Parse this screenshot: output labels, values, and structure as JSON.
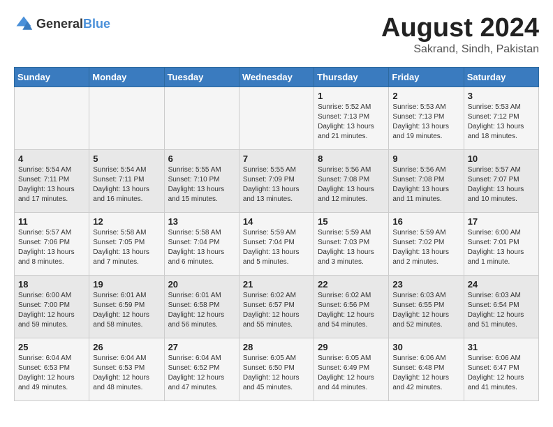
{
  "logo": {
    "text_general": "General",
    "text_blue": "Blue"
  },
  "header": {
    "month_year": "August 2024",
    "location": "Sakrand, Sindh, Pakistan"
  },
  "days_of_week": [
    "Sunday",
    "Monday",
    "Tuesday",
    "Wednesday",
    "Thursday",
    "Friday",
    "Saturday"
  ],
  "weeks": [
    [
      {
        "day": "",
        "content": ""
      },
      {
        "day": "",
        "content": ""
      },
      {
        "day": "",
        "content": ""
      },
      {
        "day": "",
        "content": ""
      },
      {
        "day": "1",
        "content": "Sunrise: 5:52 AM\nSunset: 7:13 PM\nDaylight: 13 hours\nand 21 minutes."
      },
      {
        "day": "2",
        "content": "Sunrise: 5:53 AM\nSunset: 7:13 PM\nDaylight: 13 hours\nand 19 minutes."
      },
      {
        "day": "3",
        "content": "Sunrise: 5:53 AM\nSunset: 7:12 PM\nDaylight: 13 hours\nand 18 minutes."
      }
    ],
    [
      {
        "day": "4",
        "content": "Sunrise: 5:54 AM\nSunset: 7:11 PM\nDaylight: 13 hours\nand 17 minutes."
      },
      {
        "day": "5",
        "content": "Sunrise: 5:54 AM\nSunset: 7:11 PM\nDaylight: 13 hours\nand 16 minutes."
      },
      {
        "day": "6",
        "content": "Sunrise: 5:55 AM\nSunset: 7:10 PM\nDaylight: 13 hours\nand 15 minutes."
      },
      {
        "day": "7",
        "content": "Sunrise: 5:55 AM\nSunset: 7:09 PM\nDaylight: 13 hours\nand 13 minutes."
      },
      {
        "day": "8",
        "content": "Sunrise: 5:56 AM\nSunset: 7:08 PM\nDaylight: 13 hours\nand 12 minutes."
      },
      {
        "day": "9",
        "content": "Sunrise: 5:56 AM\nSunset: 7:08 PM\nDaylight: 13 hours\nand 11 minutes."
      },
      {
        "day": "10",
        "content": "Sunrise: 5:57 AM\nSunset: 7:07 PM\nDaylight: 13 hours\nand 10 minutes."
      }
    ],
    [
      {
        "day": "11",
        "content": "Sunrise: 5:57 AM\nSunset: 7:06 PM\nDaylight: 13 hours\nand 8 minutes."
      },
      {
        "day": "12",
        "content": "Sunrise: 5:58 AM\nSunset: 7:05 PM\nDaylight: 13 hours\nand 7 minutes."
      },
      {
        "day": "13",
        "content": "Sunrise: 5:58 AM\nSunset: 7:04 PM\nDaylight: 13 hours\nand 6 minutes."
      },
      {
        "day": "14",
        "content": "Sunrise: 5:59 AM\nSunset: 7:04 PM\nDaylight: 13 hours\nand 5 minutes."
      },
      {
        "day": "15",
        "content": "Sunrise: 5:59 AM\nSunset: 7:03 PM\nDaylight: 13 hours\nand 3 minutes."
      },
      {
        "day": "16",
        "content": "Sunrise: 5:59 AM\nSunset: 7:02 PM\nDaylight: 13 hours\nand 2 minutes."
      },
      {
        "day": "17",
        "content": "Sunrise: 6:00 AM\nSunset: 7:01 PM\nDaylight: 13 hours\nand 1 minute."
      }
    ],
    [
      {
        "day": "18",
        "content": "Sunrise: 6:00 AM\nSunset: 7:00 PM\nDaylight: 12 hours\nand 59 minutes."
      },
      {
        "day": "19",
        "content": "Sunrise: 6:01 AM\nSunset: 6:59 PM\nDaylight: 12 hours\nand 58 minutes."
      },
      {
        "day": "20",
        "content": "Sunrise: 6:01 AM\nSunset: 6:58 PM\nDaylight: 12 hours\nand 56 minutes."
      },
      {
        "day": "21",
        "content": "Sunrise: 6:02 AM\nSunset: 6:57 PM\nDaylight: 12 hours\nand 55 minutes."
      },
      {
        "day": "22",
        "content": "Sunrise: 6:02 AM\nSunset: 6:56 PM\nDaylight: 12 hours\nand 54 minutes."
      },
      {
        "day": "23",
        "content": "Sunrise: 6:03 AM\nSunset: 6:55 PM\nDaylight: 12 hours\nand 52 minutes."
      },
      {
        "day": "24",
        "content": "Sunrise: 6:03 AM\nSunset: 6:54 PM\nDaylight: 12 hours\nand 51 minutes."
      }
    ],
    [
      {
        "day": "25",
        "content": "Sunrise: 6:04 AM\nSunset: 6:53 PM\nDaylight: 12 hours\nand 49 minutes."
      },
      {
        "day": "26",
        "content": "Sunrise: 6:04 AM\nSunset: 6:53 PM\nDaylight: 12 hours\nand 48 minutes."
      },
      {
        "day": "27",
        "content": "Sunrise: 6:04 AM\nSunset: 6:52 PM\nDaylight: 12 hours\nand 47 minutes."
      },
      {
        "day": "28",
        "content": "Sunrise: 6:05 AM\nSunset: 6:50 PM\nDaylight: 12 hours\nand 45 minutes."
      },
      {
        "day": "29",
        "content": "Sunrise: 6:05 AM\nSunset: 6:49 PM\nDaylight: 12 hours\nand 44 minutes."
      },
      {
        "day": "30",
        "content": "Sunrise: 6:06 AM\nSunset: 6:48 PM\nDaylight: 12 hours\nand 42 minutes."
      },
      {
        "day": "31",
        "content": "Sunrise: 6:06 AM\nSunset: 6:47 PM\nDaylight: 12 hours\nand 41 minutes."
      }
    ]
  ]
}
